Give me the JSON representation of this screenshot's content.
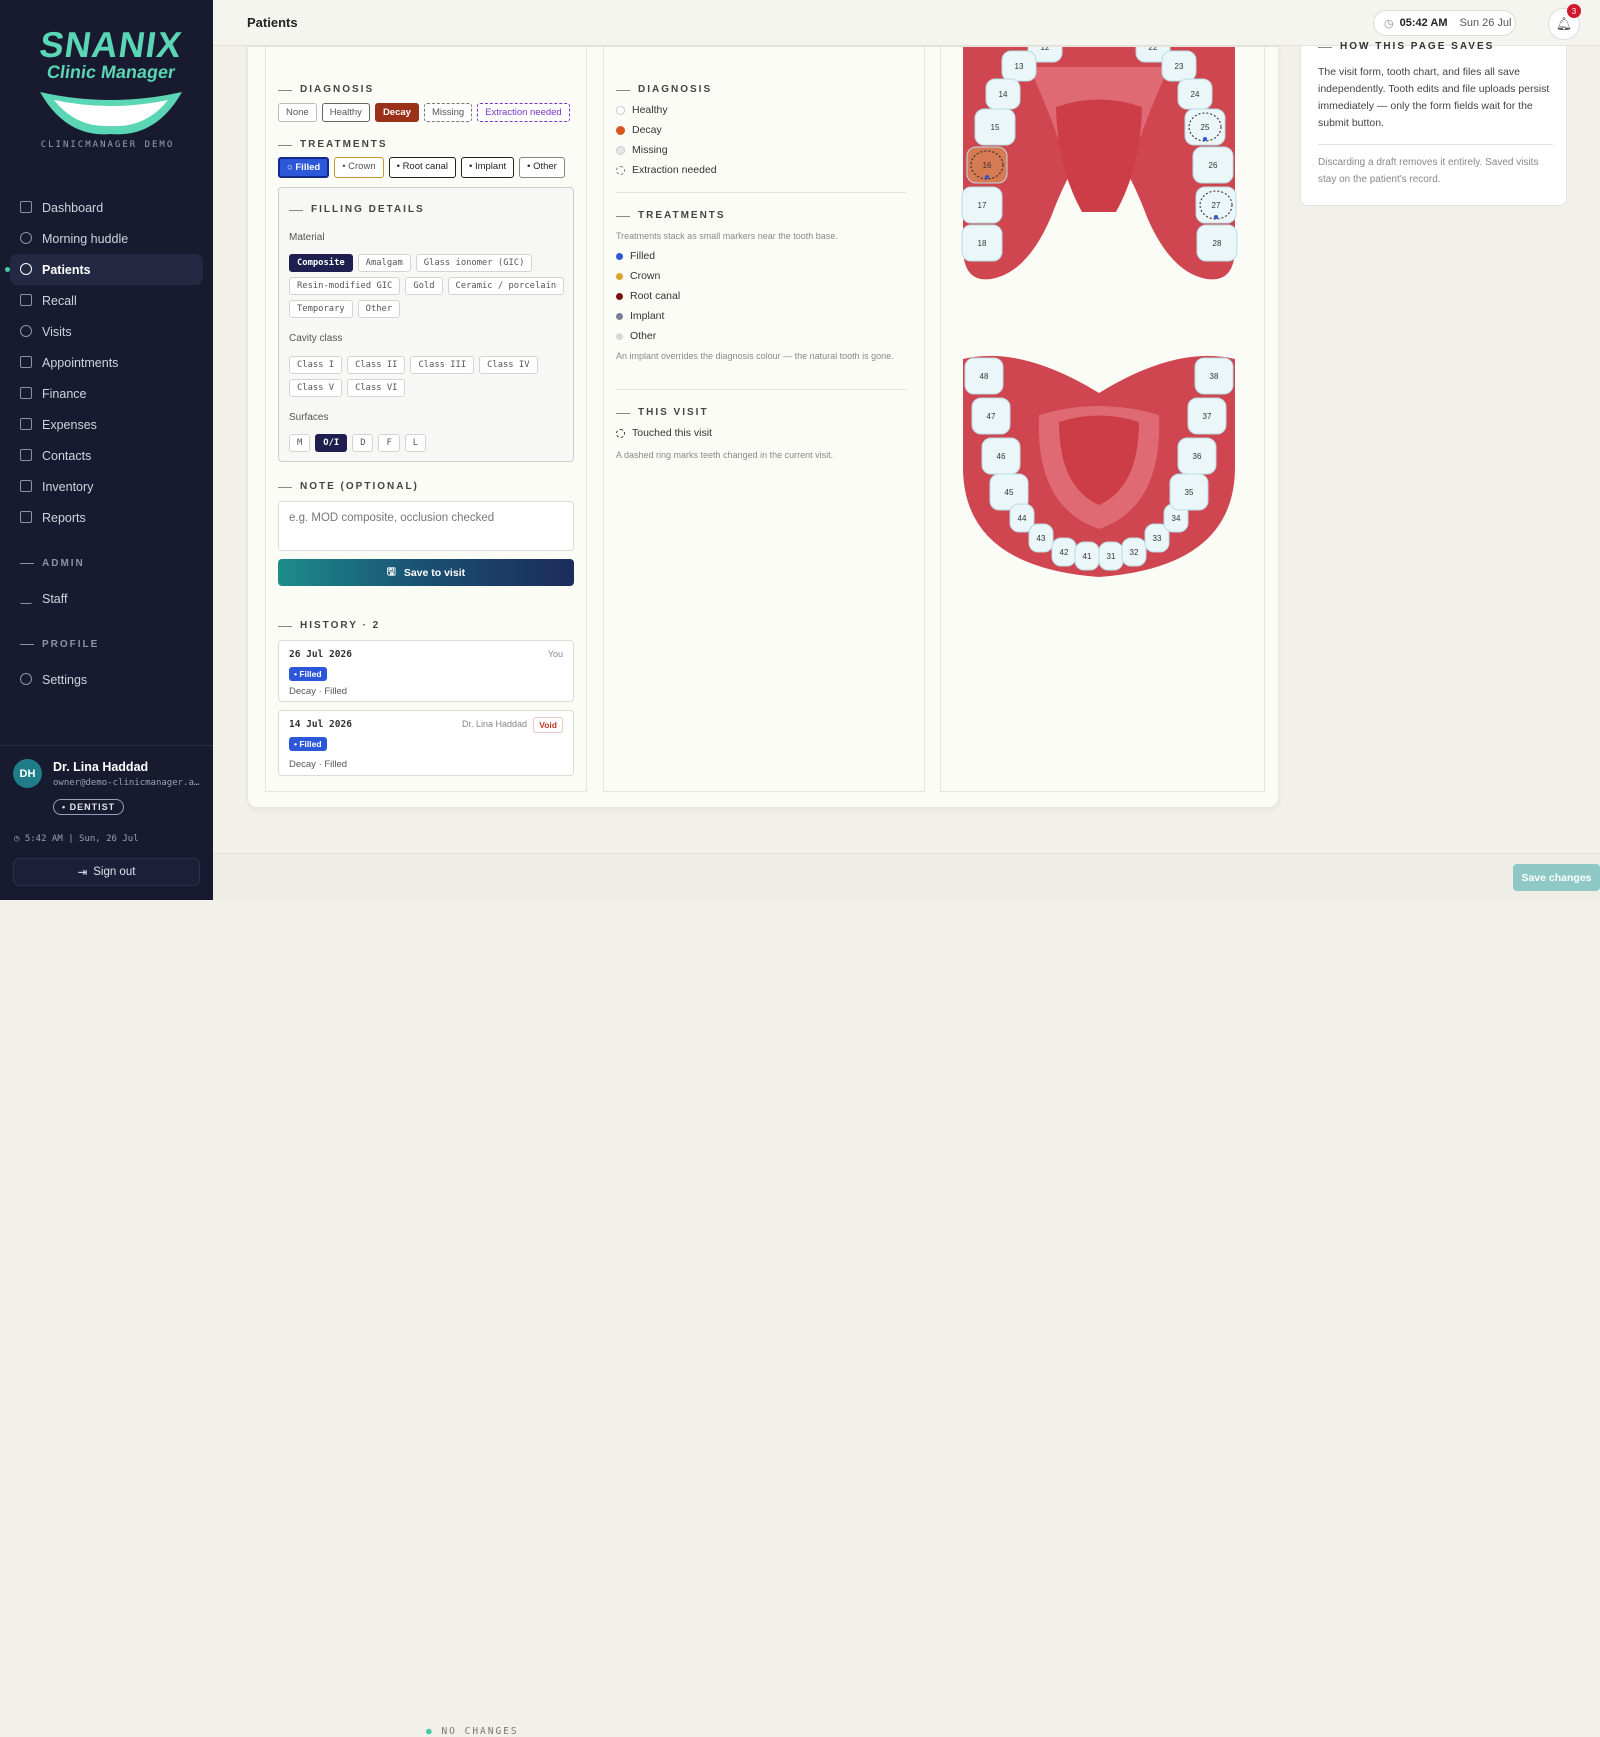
{
  "brand": {
    "line1": "SNANIX",
    "line2": "Clinic Manager",
    "sub": "CLINICMANAGER DEMO"
  },
  "nav": [
    {
      "label": "Dashboard",
      "icon": "grid-icon"
    },
    {
      "label": "Morning huddle",
      "icon": "people-icon"
    },
    {
      "label": "Patients",
      "icon": "users-icon",
      "active": true
    },
    {
      "label": "Recall",
      "icon": "calendar-icon"
    },
    {
      "label": "Visits",
      "icon": "clock-icon"
    },
    {
      "label": "Appointments",
      "icon": "calendar-icon"
    },
    {
      "label": "Finance",
      "icon": "file-icon"
    },
    {
      "label": "Expenses",
      "icon": "receipt-icon"
    },
    {
      "label": "Contacts",
      "icon": "book-icon"
    },
    {
      "label": "Inventory",
      "icon": "box-icon"
    },
    {
      "label": "Reports",
      "icon": "chart-icon"
    }
  ],
  "admin": {
    "title": "ADMIN",
    "items": [
      {
        "label": "Staff",
        "icon": "pulse-icon"
      }
    ]
  },
  "profile": {
    "title": "PROFILE",
    "items": [
      {
        "label": "Settings",
        "icon": "gear-icon"
      }
    ]
  },
  "user": {
    "initials": "DH",
    "name": "Dr. Lina Haddad",
    "email": "owner@demo-clinicmanager.a…",
    "role": "• DENTIST"
  },
  "footer_clock": "5:42 AM  |  Sun, 26 Jul",
  "signout": "Sign out",
  "topbar": {
    "title": "Patients",
    "time": "05:42 AM",
    "date": "Sun 26 Jul",
    "notifications": "3"
  },
  "left": {
    "diagnosis_title": "DIAGNOSIS",
    "diagnosis": [
      "None",
      "Healthy",
      "Decay",
      "Missing",
      "Extraction needed"
    ],
    "treatments_title": "TREATMENTS",
    "treatments": [
      "○ Filled",
      "• Crown",
      "• Root canal",
      "• Implant",
      "• Other"
    ],
    "filling_title": "FILLING DETAILS",
    "material_label": "Material",
    "materials": [
      "Composite",
      "Amalgam",
      "Glass ionomer (GIC)",
      "Resin-modified GIC",
      "Gold",
      "Ceramic / porcelain",
      "Temporary",
      "Other"
    ],
    "cavity_label": "Cavity class",
    "cavity": [
      "Class I",
      "Class II",
      "Class III",
      "Class IV",
      "Class V",
      "Class VI"
    ],
    "surfaces_label": "Surfaces",
    "surfaces": [
      "M",
      "O/I",
      "D",
      "F",
      "L"
    ],
    "note_title": "NOTE (OPTIONAL)",
    "note_placeholder": "e.g. MOD composite, occlusion checked",
    "save_label": "Save to visit",
    "history_title": "HISTORY · 2",
    "history": [
      {
        "date": "26 Jul 2026",
        "who": "You",
        "badge": "• Filled",
        "text": "Decay · Filled"
      },
      {
        "date": "14 Jul 2026",
        "who": "Dr. Lina Haddad",
        "void": "Void",
        "badge": "• Filled",
        "text": "Decay · Filled"
      }
    ]
  },
  "legend": {
    "diagnosis_title": "DIAGNOSIS",
    "diagnosis": [
      {
        "label": "Healthy",
        "color": "#ffffff"
      },
      {
        "label": "Decay",
        "color": "#d9541e"
      },
      {
        "label": "Missing",
        "color": "#e6e6e6"
      },
      {
        "label": "Extraction needed",
        "color": "dashed"
      }
    ],
    "treatments_title": "TREATMENTS",
    "treatments_note": "Treatments stack as small markers near the tooth base.",
    "treatments": [
      {
        "label": "Filled",
        "color": "#2c57d8"
      },
      {
        "label": "Crown",
        "color": "#d8a52e"
      },
      {
        "label": "Root canal",
        "color": "#7a1010"
      },
      {
        "label": "Implant",
        "color": "#7a7f95"
      },
      {
        "label": "Other",
        "color": "#d8d8d8"
      }
    ],
    "implant_note": "An implant overrides the diagnosis colour — the natural tooth is gone.",
    "visit_title": "THIS VISIT",
    "visit_item": "Touched this visit",
    "visit_note": "A dashed ring marks teeth changed in the current visit."
  },
  "upper_teeth": [
    "12",
    "13",
    "14",
    "15",
    "16",
    "17",
    "18",
    "22",
    "23",
    "24",
    "25",
    "26",
    "27",
    "28"
  ],
  "lower_teeth": [
    "48",
    "47",
    "46",
    "45",
    "44",
    "43",
    "42",
    "41",
    "31",
    "32",
    "33",
    "34",
    "35",
    "36",
    "37",
    "38"
  ],
  "info": {
    "title": "HOW THIS PAGE SAVES",
    "p1": "The visit form, tooth chart, and files all save independently. Tooth edits and file uploads persist immediately — only the form fields wait for the submit button.",
    "p2": "Discarding a draft removes it entirely. Saved visits stay on the patient's record."
  },
  "bottom": {
    "status": "NO CHANGES",
    "save": "Save changes"
  }
}
